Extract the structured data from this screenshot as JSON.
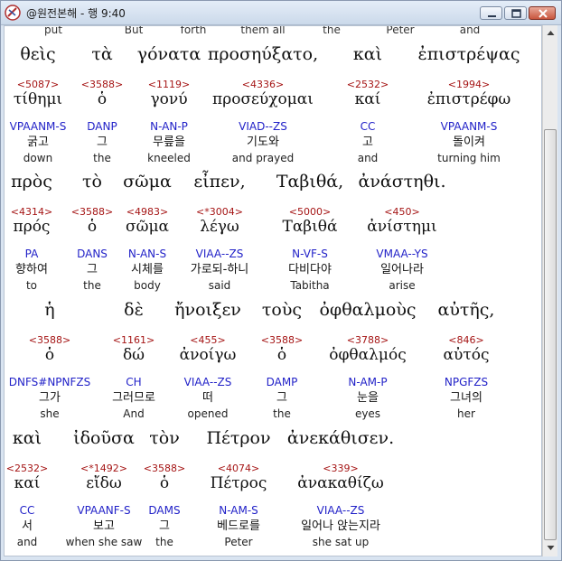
{
  "window": {
    "title": "@원전본해 - 행 9:40",
    "buttons": {
      "minimize": "minimize-button",
      "maximize": "maximize-button",
      "close": "close-button"
    }
  },
  "partial_row": [
    "put",
    "But",
    "forth",
    "them all",
    "the",
    "Peter",
    "and"
  ],
  "rows": [
    {
      "words": [
        {
          "greek": "θεὶς",
          "strong": "<5087>",
          "lemma": "τίθημι",
          "parse": "VPAANM-S",
          "korean": "굵고",
          "english": "down"
        },
        {
          "greek": "τὰ",
          "strong": "<3588>",
          "lemma": "ὁ",
          "parse": "DANP",
          "korean": "그",
          "english": "the"
        },
        {
          "greek": "γόνατα",
          "strong": "<1119>",
          "lemma": "γονύ",
          "parse": "N-AN-P",
          "korean": "무릎을",
          "english": "kneeled"
        },
        {
          "greek": "προσηύξατο,",
          "strong": "<4336>",
          "lemma": "προσεύχομαι",
          "parse": "VIAD--ZS",
          "korean": "기도와",
          "english": "and prayed"
        },
        {
          "greek": "καὶ",
          "strong": "<2532>",
          "lemma": "καί",
          "parse": "CC",
          "korean": "고",
          "english": "and"
        },
        {
          "greek": "ἐπιστρέψας",
          "strong": "<1994>",
          "lemma": "ἐπιστρέφω",
          "parse": "VPAANM-S",
          "korean": "돌이켜",
          "english": "turning him"
        }
      ]
    },
    {
      "words": [
        {
          "greek": "πρὸς",
          "strong": "<4314>",
          "lemma": "πρός",
          "parse": "PA",
          "korean": "향하여",
          "english": "to"
        },
        {
          "greek": "τὸ",
          "strong": "<3588>",
          "lemma": "ὁ",
          "parse": "DANS",
          "korean": "그",
          "english": "the"
        },
        {
          "greek": "σῶμα",
          "strong": "<4983>",
          "lemma": "σῶμα",
          "parse": "N-AN-S",
          "korean": "시체를",
          "english": "body"
        },
        {
          "greek": "εἶπεν,",
          "strong": "<*3004>",
          "lemma": "λέγω",
          "parse": "VIAA--ZS",
          "korean": "가로되-하니",
          "english": "said"
        },
        {
          "greek": "Ταβιθά,",
          "strong": "<5000>",
          "lemma": "Ταβιθά",
          "parse": "N-VF-S",
          "korean": "다비다야",
          "english": "Tabitha"
        },
        {
          "greek": "ἀνάστηθι.",
          "strong": "<450>",
          "lemma": "ἀνίστημι",
          "parse": "VMAA--YS",
          "korean": "일어나라",
          "english": "arise"
        }
      ]
    },
    {
      "words": [
        {
          "greek": "ἡ",
          "strong": "<3588>",
          "lemma": "ὁ",
          "parse": "DNFS#NPNFZS",
          "korean": "그가",
          "english": "she"
        },
        {
          "greek": "δὲ",
          "strong": "<1161>",
          "lemma": "δώ",
          "parse": "CH",
          "korean": "그러므로",
          "english": "And"
        },
        {
          "greek": "ἤνοιξεν",
          "strong": "<455>",
          "lemma": "ἀνοίγω",
          "parse": "VIAA--ZS",
          "korean": "떠",
          "english": "opened"
        },
        {
          "greek": "τοὺς",
          "strong": "<3588>",
          "lemma": "ὁ",
          "parse": "DAMP",
          "korean": "그",
          "english": "the"
        },
        {
          "greek": "ὀφθαλμοὺς",
          "strong": "<3788>",
          "lemma": "ὀφθαλμός",
          "parse": "N-AM-P",
          "korean": "눈을",
          "english": "eyes"
        },
        {
          "greek": "αὐτῆς,",
          "strong": "<846>",
          "lemma": "αὐτός",
          "parse": "NPGFZS",
          "korean": "그녀의",
          "english": "her"
        }
      ]
    },
    {
      "words": [
        {
          "greek": "καὶ",
          "strong": "<2532>",
          "lemma": "καί",
          "parse": "CC",
          "korean": "서",
          "english": "and"
        },
        {
          "greek": "ἰδοῦσα",
          "strong": "<*1492>",
          "lemma": "εἴδω",
          "parse": "VPAANF-S",
          "korean": "보고",
          "english": "when she saw"
        },
        {
          "greek": "τὸν",
          "strong": "<3588>",
          "lemma": "ὁ",
          "parse": "DAMS",
          "korean": "그",
          "english": "the"
        },
        {
          "greek": "Πέτρον",
          "strong": "<4074>",
          "lemma": "Πέτρος",
          "parse": "N-AM-S",
          "korean": "베드로를",
          "english": "Peter"
        },
        {
          "greek": "ἀνεκάθισεν.",
          "strong": "<339>",
          "lemma": "ἀνακαθίζω",
          "parse": "VIAA--ZS",
          "korean": "일어나 앉는지라",
          "english": "she sat up"
        }
      ]
    }
  ]
}
